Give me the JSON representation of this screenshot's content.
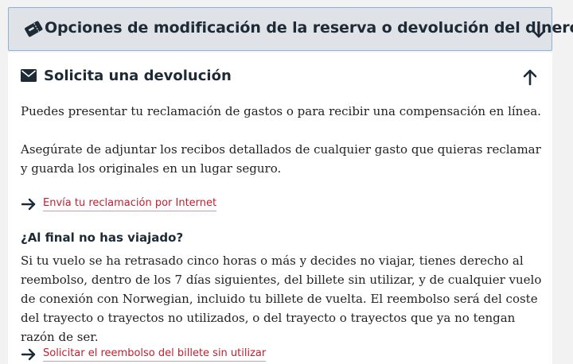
{
  "header": {
    "title": "Opciones de modificación de la reserva o devolución del dinero",
    "icon": "ticket-icon",
    "toggle_icon": "arrow-down-icon"
  },
  "section": {
    "title": "Solicita una devolución",
    "icon": "envelope-icon",
    "toggle_icon": "arrow-up-icon",
    "paragraph_1": "Puedes presentar tu reclamación de gastos o para recibir una compensación en línea.",
    "paragraph_2": "Asegúrate de adjuntar los recibos detallados de cualquier gasto que quieras reclamar y guarda los originales en un lugar seguro.",
    "link_1": "Envía tu reclamación por Internet",
    "subheading": "¿Al final no has viajado?",
    "paragraph_3": "Si tu vuelo se ha retrasado cinco horas o más y decides no viajar, tienes derecho al reembolso, dentro de los 7 días siguientes, del billete sin utilizar, y de cualquier vuelo de conexión con Norwegian, incluido tu billete de vuelta. El reembolso será del coste del trayecto o trayectos no utilizados, o del trayecto o trayectos que ya no tengan razón de ser.",
    "link_2": "Solicitar el reembolso del billete sin utilizar"
  },
  "colors": {
    "header_bg": "#dfe2e6",
    "header_border": "#8fb1d6",
    "link": "#c01f2f",
    "text": "#1e2a36"
  }
}
